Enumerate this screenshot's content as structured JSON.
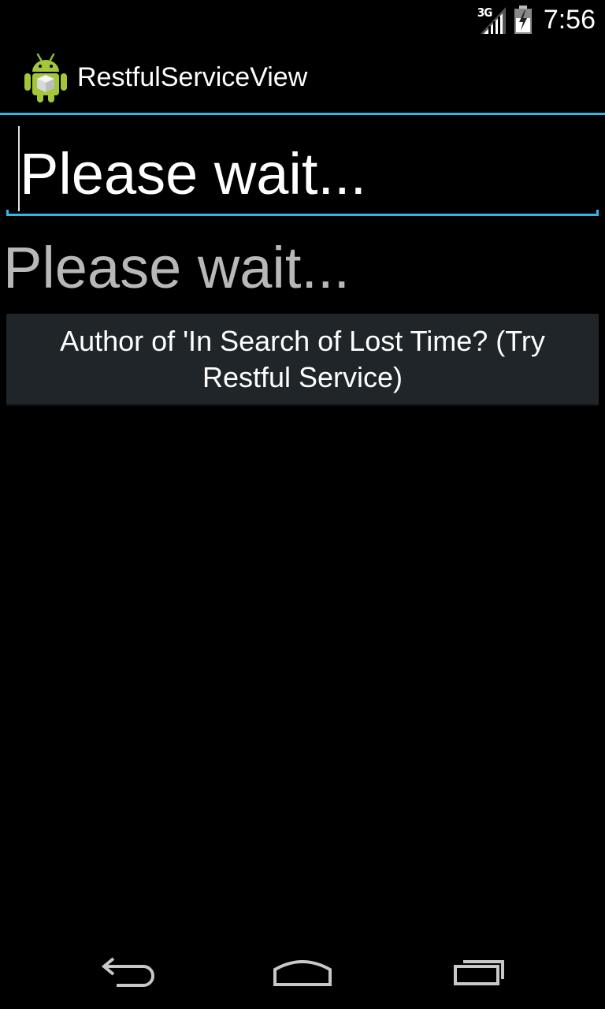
{
  "status_bar": {
    "network_type": "3G",
    "time": "7:56",
    "icons": [
      "signal-icon",
      "battery-icon"
    ]
  },
  "action_bar": {
    "app_icon": "android-app-icon",
    "title": "RestfulServiceView"
  },
  "main": {
    "edit_text_value": "Please wait...",
    "status_text": "Please wait...",
    "button_label": "Author of 'In Search of Lost Time? (Try Restful Service)"
  },
  "nav_bar": {
    "buttons": [
      "back-icon",
      "home-icon",
      "recent-apps-icon"
    ]
  },
  "colors": {
    "accent": "#33b5e5",
    "background": "#000000",
    "button_bg": "#1f2529",
    "status_text": "#b8b8b8"
  }
}
